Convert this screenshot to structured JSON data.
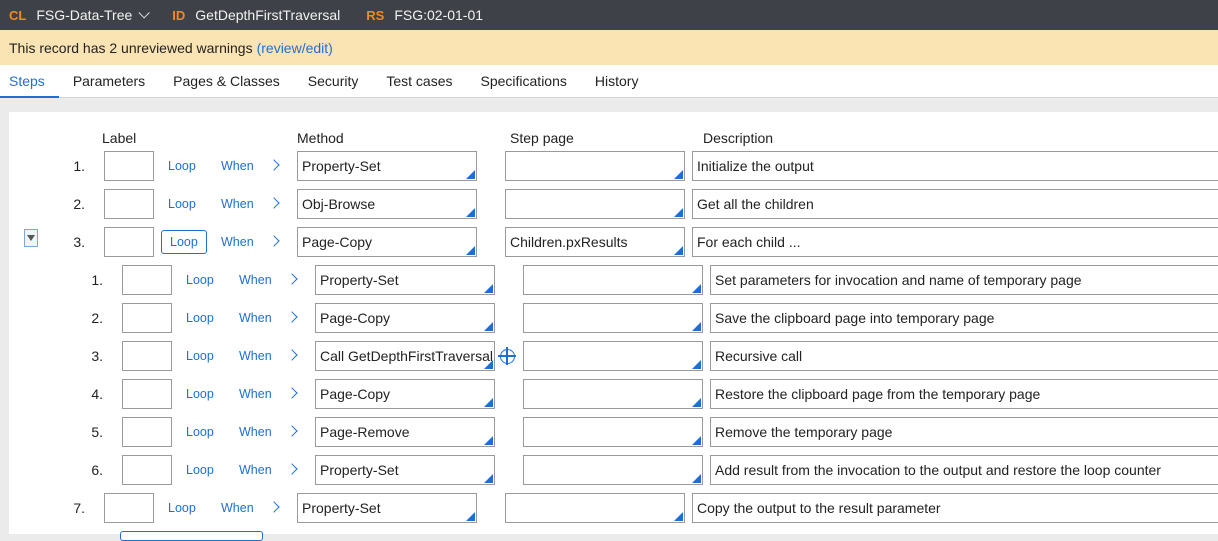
{
  "header": {
    "cl_key": "CL",
    "cl_val": "FSG-Data-Tree",
    "id_key": "ID",
    "id_val": "GetDepthFirstTraversal",
    "rs_key": "RS",
    "rs_val": "FSG:02-01-01"
  },
  "warning": {
    "text": "This record has 2 unreviewed warnings",
    "link": "(review/edit)"
  },
  "tabs": [
    "Steps",
    "Parameters",
    "Pages & Classes",
    "Security",
    "Test cases",
    "Specifications",
    "History"
  ],
  "columns": {
    "label": "Label",
    "method": "Method",
    "step_page": "Step page",
    "description": "Description"
  },
  "loop_label": "Loop",
  "when_label": "When",
  "steps": [
    {
      "num": "1.",
      "method": "Property-Set",
      "step_page": "",
      "description": "Initialize the output"
    },
    {
      "num": "2.",
      "method": "Obj-Browse",
      "step_page": "",
      "description": "Get all the children"
    },
    {
      "num": "3.",
      "method": "Page-Copy",
      "step_page": "Children.pxResults",
      "description": "For each child ..."
    },
    {
      "num": "1.",
      "method": "Property-Set",
      "step_page": "",
      "description": "Set parameters for invocation and name of temporary page"
    },
    {
      "num": "2.",
      "method": "Page-Copy",
      "step_page": "",
      "description": "Save the clipboard page into temporary page"
    },
    {
      "num": "3.",
      "method": "Call GetDepthFirstTraversal",
      "step_page": "",
      "description": "Recursive call"
    },
    {
      "num": "4.",
      "method": "Page-Copy",
      "step_page": "",
      "description": "Restore the clipboard page from the temporary page"
    },
    {
      "num": "5.",
      "method": "Page-Remove",
      "step_page": "",
      "description": "Remove the temporary page"
    },
    {
      "num": "6.",
      "method": "Property-Set",
      "step_page": "",
      "description": "Add result from the invocation to the output and restore the loop counter"
    },
    {
      "num": "7.",
      "method": "Property-Set",
      "step_page": "",
      "description": "Copy the output to the result parameter"
    }
  ]
}
